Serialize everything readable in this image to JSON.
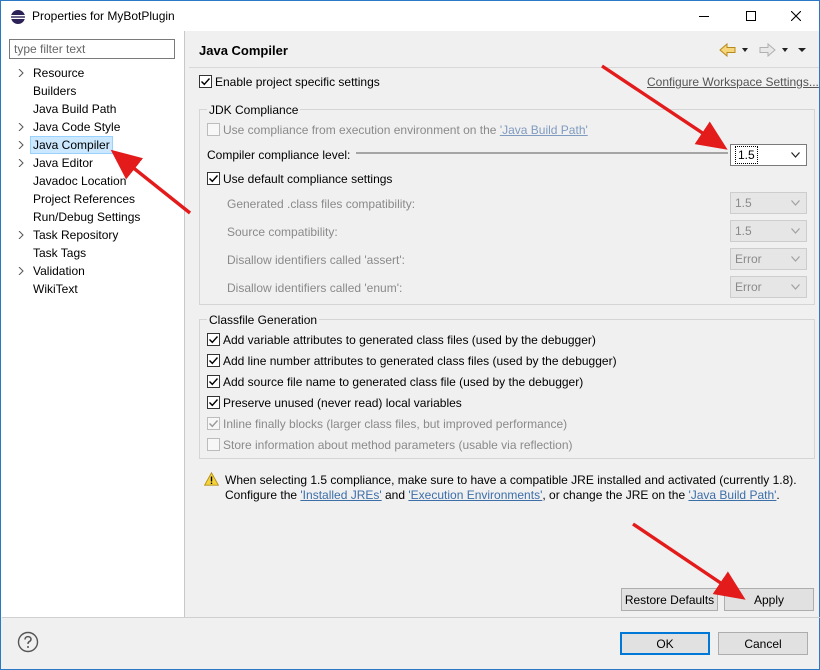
{
  "window": {
    "title": "Properties for MyBotPlugin",
    "minimize_icon": "minimize-icon",
    "maximize_icon": "maximize-icon",
    "close_icon": "close-icon"
  },
  "sidebar": {
    "filter_placeholder": "type filter text",
    "items": [
      {
        "label": "Resource",
        "expandable": true
      },
      {
        "label": "Builders",
        "expandable": false
      },
      {
        "label": "Java Build Path",
        "expandable": false
      },
      {
        "label": "Java Code Style",
        "expandable": true
      },
      {
        "label": "Java Compiler",
        "expandable": true,
        "selected": true
      },
      {
        "label": "Java Editor",
        "expandable": true
      },
      {
        "label": "Javadoc Location",
        "expandable": false
      },
      {
        "label": "Project References",
        "expandable": false
      },
      {
        "label": "Run/Debug Settings",
        "expandable": false
      },
      {
        "label": "Task Repository",
        "expandable": true
      },
      {
        "label": "Task Tags",
        "expandable": false
      },
      {
        "label": "Validation",
        "expandable": true
      },
      {
        "label": "WikiText",
        "expandable": false
      }
    ]
  },
  "main": {
    "title": "Java Compiler",
    "enable_specific": {
      "label": "Enable project specific settings",
      "checked": true
    },
    "configure_workspace_link": "Configure Workspace Settings...",
    "jdk_group": {
      "title": "JDK Compliance",
      "use_env_prefix": "Use compliance from execution environment on the ",
      "use_env_link": "'Java Build Path'",
      "compliance_level_label": "Compiler compliance level:",
      "compliance_level_value": "1.5",
      "use_default": {
        "label": "Use default compliance settings",
        "checked": true
      },
      "rows": [
        {
          "label": "Generated .class files compatibility:",
          "value": "1.5"
        },
        {
          "label": "Source compatibility:",
          "value": "1.5"
        },
        {
          "label": "Disallow identifiers called 'assert':",
          "value": "Error"
        },
        {
          "label": "Disallow identifiers called 'enum':",
          "value": "Error"
        }
      ]
    },
    "classfile_group": {
      "title": "Classfile Generation",
      "options": [
        {
          "label": "Add variable attributes to generated class files (used by the debugger)",
          "checked": true,
          "enabled": true
        },
        {
          "label": "Add line number attributes to generated class files (used by the debugger)",
          "checked": true,
          "enabled": true
        },
        {
          "label": "Add source file name to generated class file (used by the debugger)",
          "checked": true,
          "enabled": true
        },
        {
          "label": "Preserve unused (never read) local variables",
          "checked": true,
          "enabled": true
        },
        {
          "label": "Inline finally blocks (larger class files, but improved performance)",
          "checked": true,
          "enabled": false
        },
        {
          "label": "Store information about method parameters (usable via reflection)",
          "checked": false,
          "enabled": false
        }
      ]
    },
    "warning": {
      "line1": "When selecting 1.5 compliance, make sure to have a compatible JRE installed and activated (currently 1.8).",
      "line2_a": "Configure the ",
      "link_installed_jres": "'Installed JREs'",
      "line2_b": " and ",
      "link_exec_envs": "'Execution Environments'",
      "line2_c": ", or change the JRE on the ",
      "link_build_path": "'Java Build Path'",
      "line2_d": "."
    },
    "restore_defaults": "Restore Defaults",
    "apply": "Apply"
  },
  "footer": {
    "ok": "OK",
    "cancel": "Cancel"
  },
  "colors": {
    "accent": "#0078d7",
    "arrow_red": "#e31b1b",
    "link": "#3c6ea8"
  }
}
